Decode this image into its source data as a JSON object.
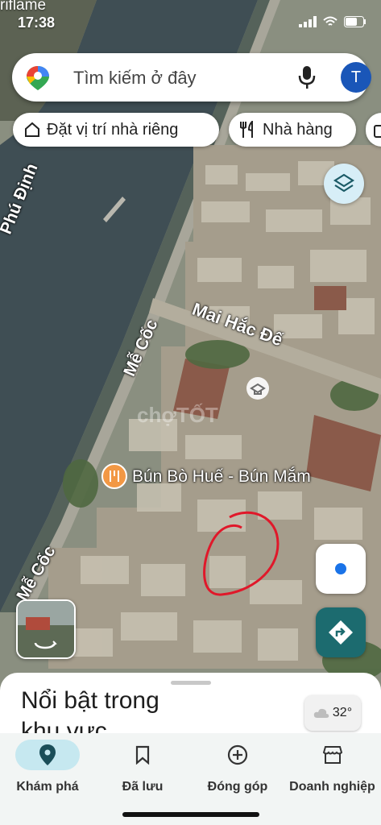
{
  "status_bar": {
    "brand_text": "riflame",
    "time": "17:38"
  },
  "search": {
    "placeholder": "Tìm kiếm ở đây",
    "avatar_letter": "T"
  },
  "chips": [
    {
      "label": "Đặt vị trí nhà riêng"
    },
    {
      "label": "Nhà hàng"
    }
  ],
  "map_labels": {
    "street_phu_dinh": "Phú Định",
    "street_me_coc_1": "Mễ Cốc",
    "street_mai_hac_de": "Mai Hắc Đế",
    "street_me_coc_2": "Mễ Cốc",
    "poi_restaurant": "Bún Bò Huế - Bún Mắm",
    "watermark": "chợTỐT"
  },
  "sheet": {
    "title_line1": "Nổi bật trong",
    "title_line2": "khu vực",
    "temperature": "32°"
  },
  "nav": [
    {
      "label": "Khám phá",
      "icon": "location-pin-icon",
      "active": true
    },
    {
      "label": "Đã lưu",
      "icon": "bookmark-icon",
      "active": false
    },
    {
      "label": "Đóng góp",
      "icon": "add-circle-icon",
      "active": false
    },
    {
      "label": "Doanh nghiệp",
      "icon": "storefront-icon",
      "active": false
    }
  ],
  "colors": {
    "accent": "#1a73e8",
    "nav_active_bg": "#c6e8f0",
    "direction_button": "#1c6b6f",
    "annotation": "#e0182a"
  }
}
